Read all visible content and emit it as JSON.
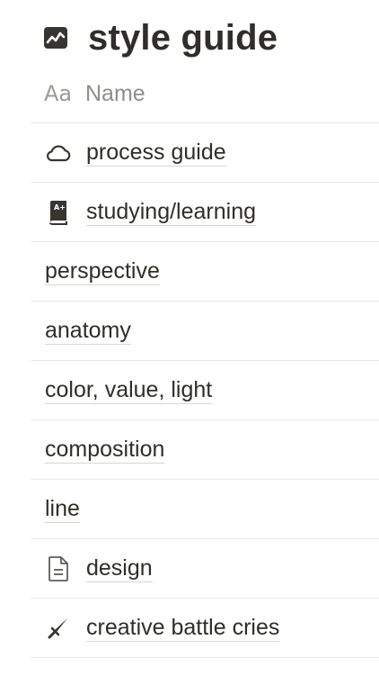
{
  "database": {
    "title": "style guide",
    "icon": "chart-icon"
  },
  "column": {
    "type_icon_label": "Aa",
    "label": "Name"
  },
  "rows": [
    {
      "title": "process guide",
      "icon": "cloud-icon"
    },
    {
      "title": "studying/learning",
      "icon": "book-icon"
    },
    {
      "title": "perspective",
      "icon": ""
    },
    {
      "title": "anatomy",
      "icon": ""
    },
    {
      "title": "color, value, light",
      "icon": ""
    },
    {
      "title": "composition",
      "icon": ""
    },
    {
      "title": "line",
      "icon": ""
    },
    {
      "title": "design",
      "icon": "document-icon"
    },
    {
      "title": "creative battle cries",
      "icon": "sword-icon"
    }
  ],
  "colors": {
    "text": "#37352f",
    "muted": "#9b9a97",
    "divider": "#e9e9e7"
  }
}
